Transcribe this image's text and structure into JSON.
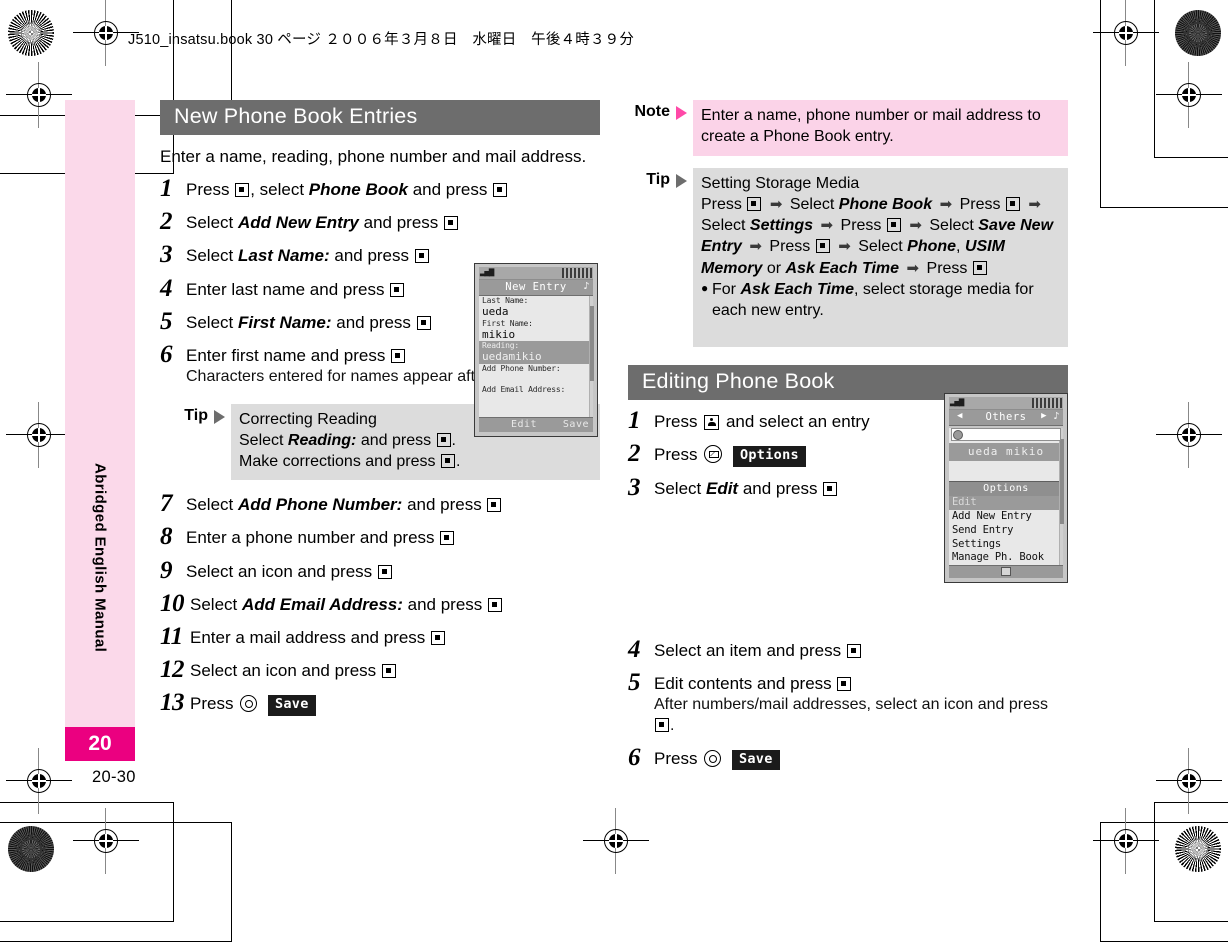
{
  "header": {
    "running_head": "J510_insatsu.book  30 ページ  ２００６年３月８日　水曜日　午後４時３９分"
  },
  "side_tab": {
    "label": "Abridged English Manual",
    "chapter_number": "20",
    "folio": "20-30"
  },
  "left_column": {
    "section_title": "New Phone Book Entries",
    "intro": "Enter a name, reading, phone number and mail address.",
    "steps": [
      {
        "num": "1",
        "text_parts": [
          "Press ",
          "[SQ]",
          ", select ",
          "*Phone Book*",
          " and press ",
          "[SQ]"
        ]
      },
      {
        "num": "2",
        "text_parts": [
          "Select ",
          "*Add New Entry*",
          " and press ",
          "[SQ]"
        ]
      },
      {
        "num": "3",
        "text_parts": [
          "Select ",
          "*Last Name:*",
          " and press ",
          "[SQ]"
        ]
      },
      {
        "num": "4",
        "text_parts": [
          "Enter last name and press ",
          "[SQ]"
        ]
      },
      {
        "num": "5",
        "text_parts": [
          "Select ",
          "*First Name:*",
          " and press ",
          "[SQ]"
        ]
      },
      {
        "num": "6",
        "text_parts": [
          "Enter first name and press ",
          "[SQ]"
        ],
        "sub": "Characters entered for names appear after *Reading:*."
      },
      {
        "num": "7",
        "text_parts": [
          "Select ",
          "*Add Phone Number:*",
          " and press ",
          "[SQ]"
        ]
      },
      {
        "num": "8",
        "text_parts": [
          "Enter a phone number and press ",
          "[SQ]"
        ]
      },
      {
        "num": "9",
        "text_parts": [
          "Select an icon and press ",
          "[SQ]"
        ]
      },
      {
        "num": "10",
        "text_parts": [
          "Select ",
          "*Add Email Address:*",
          " and press ",
          "[SQ]"
        ]
      },
      {
        "num": "11",
        "text_parts": [
          "Enter a mail address and press ",
          "[SQ]"
        ]
      },
      {
        "num": "12",
        "text_parts": [
          "Select an icon and press ",
          "[SQ]"
        ]
      },
      {
        "num": "13",
        "text_parts": [
          "Press ",
          "[CIRC]",
          " [SAVE]"
        ]
      }
    ],
    "step_labels": {
      "s1_a": "Press",
      "s1_b": ", select",
      "s1_c": "Phone Book",
      "s1_d": "and press",
      "s2_a": "Select",
      "s2_b": "Add New Entry",
      "s2_c": "and press",
      "s3_a": "Select",
      "s3_b": "Last Name:",
      "s3_c": "and press",
      "s4_a": "Enter last name and press",
      "s5_a": "Select",
      "s5_b": "First Name:",
      "s5_c": "and press",
      "s6_a": "Enter first name and press",
      "s6_sub_a": "Characters entered for names appear after",
      "s6_sub_b": "Reading:",
      "s6_sub_c": ".",
      "s7_a": "Select",
      "s7_b": "Add Phone Number:",
      "s7_c": "and press",
      "s8_a": "Enter a phone number and press",
      "s9_a": "Select an icon and press",
      "s10_a": "Select",
      "s10_b": "Add Email Address:",
      "s10_c": "and press",
      "s11_a": "Enter a mail address and press",
      "s12_a": "Select an icon and press",
      "s13_a": "Press",
      "s13_save": "Save"
    },
    "tip": {
      "label": "Tip",
      "title": "Correcting Reading",
      "line2_a": "Select",
      "line2_b": "Reading:",
      "line2_c": "and press",
      "line2_d": ".",
      "line3_a": "Make corrections and press",
      "line3_b": "."
    }
  },
  "right_column": {
    "note": {
      "label": "Note",
      "text": "Enter a name, phone number or mail address to create a Phone Book entry."
    },
    "tip": {
      "label": "Tip",
      "title": "Setting Storage Media",
      "seq": {
        "press1": "Press",
        "sel1": "Select",
        "phone_book": "Phone Book",
        "press2": "Press",
        "sel2": "Select",
        "settings": "Settings",
        "press3": "Press",
        "sel3": "Select",
        "save_new_entry": "Save New Entry",
        "press4": "Press",
        "sel4": "Select",
        "phone": "Phone",
        "comma": ",",
        "usim": "USIM Memory",
        "or": "or",
        "ask_each_time": "Ask Each Time",
        "press5": "Press"
      },
      "bullet": {
        "a": "For",
        "b": "Ask Each Time",
        "c": ", select storage media for each new entry."
      }
    },
    "section_title": "Editing Phone Book",
    "steps_labels": {
      "s1_a": "Press",
      "s1_b": "and select an entry",
      "s2_a": "Press",
      "s2_options": "Options",
      "s3_a": "Select",
      "s3_b": "Edit",
      "s3_c": "and press",
      "s4_a": "Select an item and press",
      "s5_a": "Edit contents and press",
      "s5_sub_a": "After numbers/mail addresses, select an icon and press",
      "s5_sub_b": ".",
      "s6_a": "Press",
      "s6_save": "Save"
    },
    "step_nums": {
      "n1": "1",
      "n2": "2",
      "n3": "3",
      "n4": "4",
      "n5": "5",
      "n6": "6"
    }
  },
  "phone_mock_1": {
    "title": "New Entry",
    "rows": [
      {
        "label": "Last Name:",
        "value": "ueda",
        "selected": false
      },
      {
        "label": "First Name:",
        "value": "mikio",
        "selected": false
      },
      {
        "label": "Reading:",
        "value": "uedamikio",
        "selected": true
      },
      {
        "label": "Add Phone Number:",
        "value": "",
        "selected": false
      },
      {
        "label": "Add Email Address:",
        "value": "",
        "selected": false
      }
    ],
    "labels": {
      "last_name": "Last Name:",
      "last_name_val": "ueda",
      "first_name": "First Name:",
      "first_name_val": "mikio",
      "reading": "Reading:",
      "reading_val": "uedamikio",
      "add_phone": "Add Phone Number:",
      "add_email": "Add Email Address:"
    },
    "softkey_left": "Edit",
    "softkey_right": "Save"
  },
  "phone_mock_2": {
    "title": "Others",
    "entry": "ueda mikio",
    "options_bar": "Options",
    "menu": [
      {
        "label": "Edit",
        "selected": true
      },
      {
        "label": "Add New Entry",
        "selected": false
      },
      {
        "label": "Send Entry",
        "selected": false
      },
      {
        "label": "Settings",
        "selected": false
      },
      {
        "label": "Manage Ph. Book",
        "selected": false
      }
    ]
  },
  "colors": {
    "heading_bar": "#6d6d6d",
    "note_bg": "#fbd3e8",
    "tip_bg": "#dcdcdc",
    "tab_pink": "#fbd9ea",
    "tab_magenta": "#eb0080"
  }
}
